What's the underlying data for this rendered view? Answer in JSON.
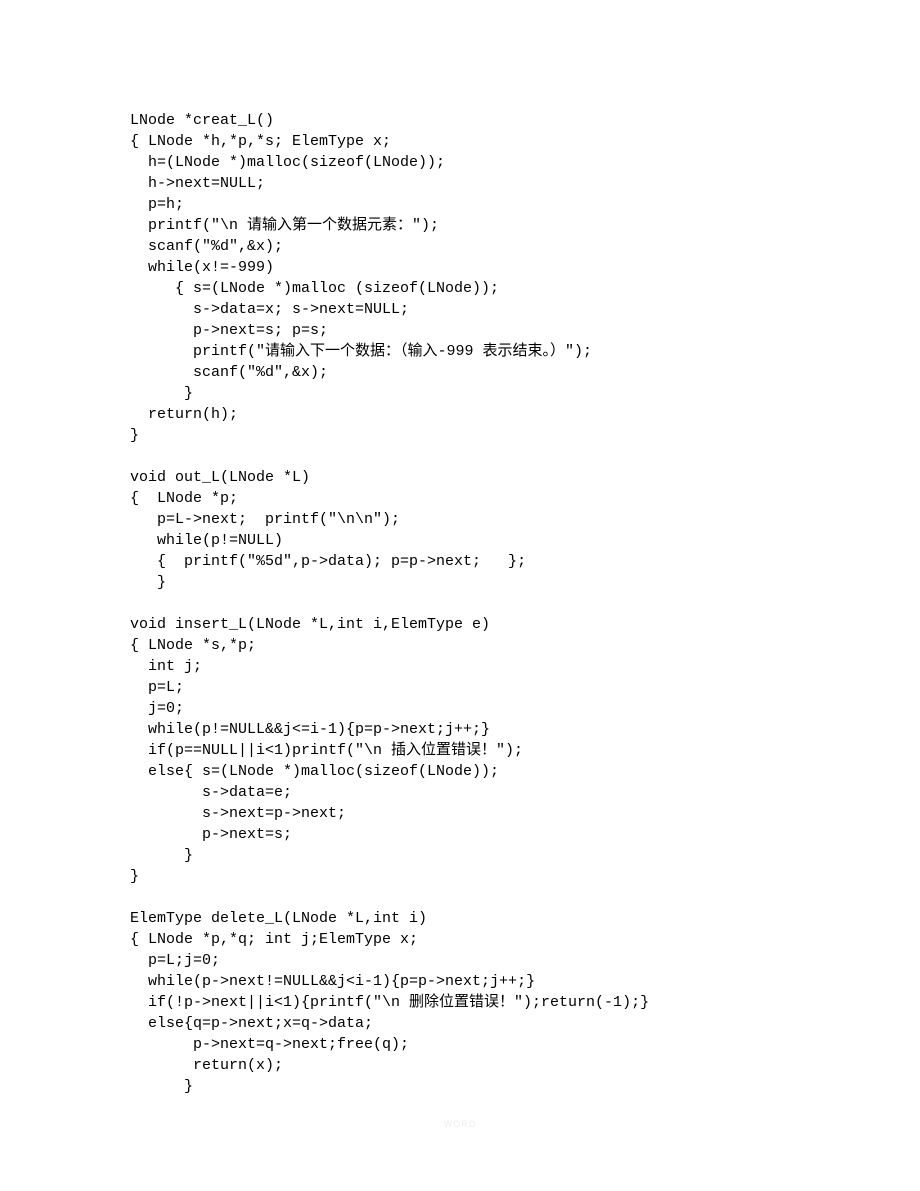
{
  "code": "LNode *creat_L()\n{ LNode *h,*p,*s; ElemType x;\n  h=(LNode *)malloc(sizeof(LNode));\n  h->next=NULL;\n  p=h;\n  printf(\"\\n 请输入第一个数据元素：\");\n  scanf(\"%d\",&x);\n  while(x!=-999)\n     { s=(LNode *)malloc (sizeof(LNode));\n       s->data=x; s->next=NULL;\n       p->next=s; p=s;\n       printf(\"请输入下一个数据：（输入-999 表示结束。）\");\n       scanf(\"%d\",&x);\n      }\n  return(h);\n}\n\nvoid out_L(LNode *L)\n{  LNode *p;\n   p=L->next;  printf(\"\\n\\n\");\n   while(p!=NULL)\n   {  printf(\"%5d\",p->data); p=p->next;   };\n   }\n\nvoid insert_L(LNode *L,int i,ElemType e)\n{ LNode *s,*p;\n  int j;\n  p=L;\n  j=0;\n  while(p!=NULL&&j<=i-1){p=p->next;j++;}\n  if(p==NULL||i<1)printf(\"\\n 插入位置错误！\");\n  else{ s=(LNode *)malloc(sizeof(LNode));\n        s->data=e;\n        s->next=p->next;\n        p->next=s;\n      }\n}\n\nElemType delete_L(LNode *L,int i)\n{ LNode *p,*q; int j;ElemType x;\n  p=L;j=0;\n  while(p->next!=NULL&&j<i-1){p=p->next;j++;}\n  if(!p->next||i<1){printf(\"\\n 删除位置错误！\");return(-1);}\n  else{q=p->next;x=q->data;\n       p->next=q->next;free(q);\n       return(x);\n      }",
  "footer": "WORD"
}
